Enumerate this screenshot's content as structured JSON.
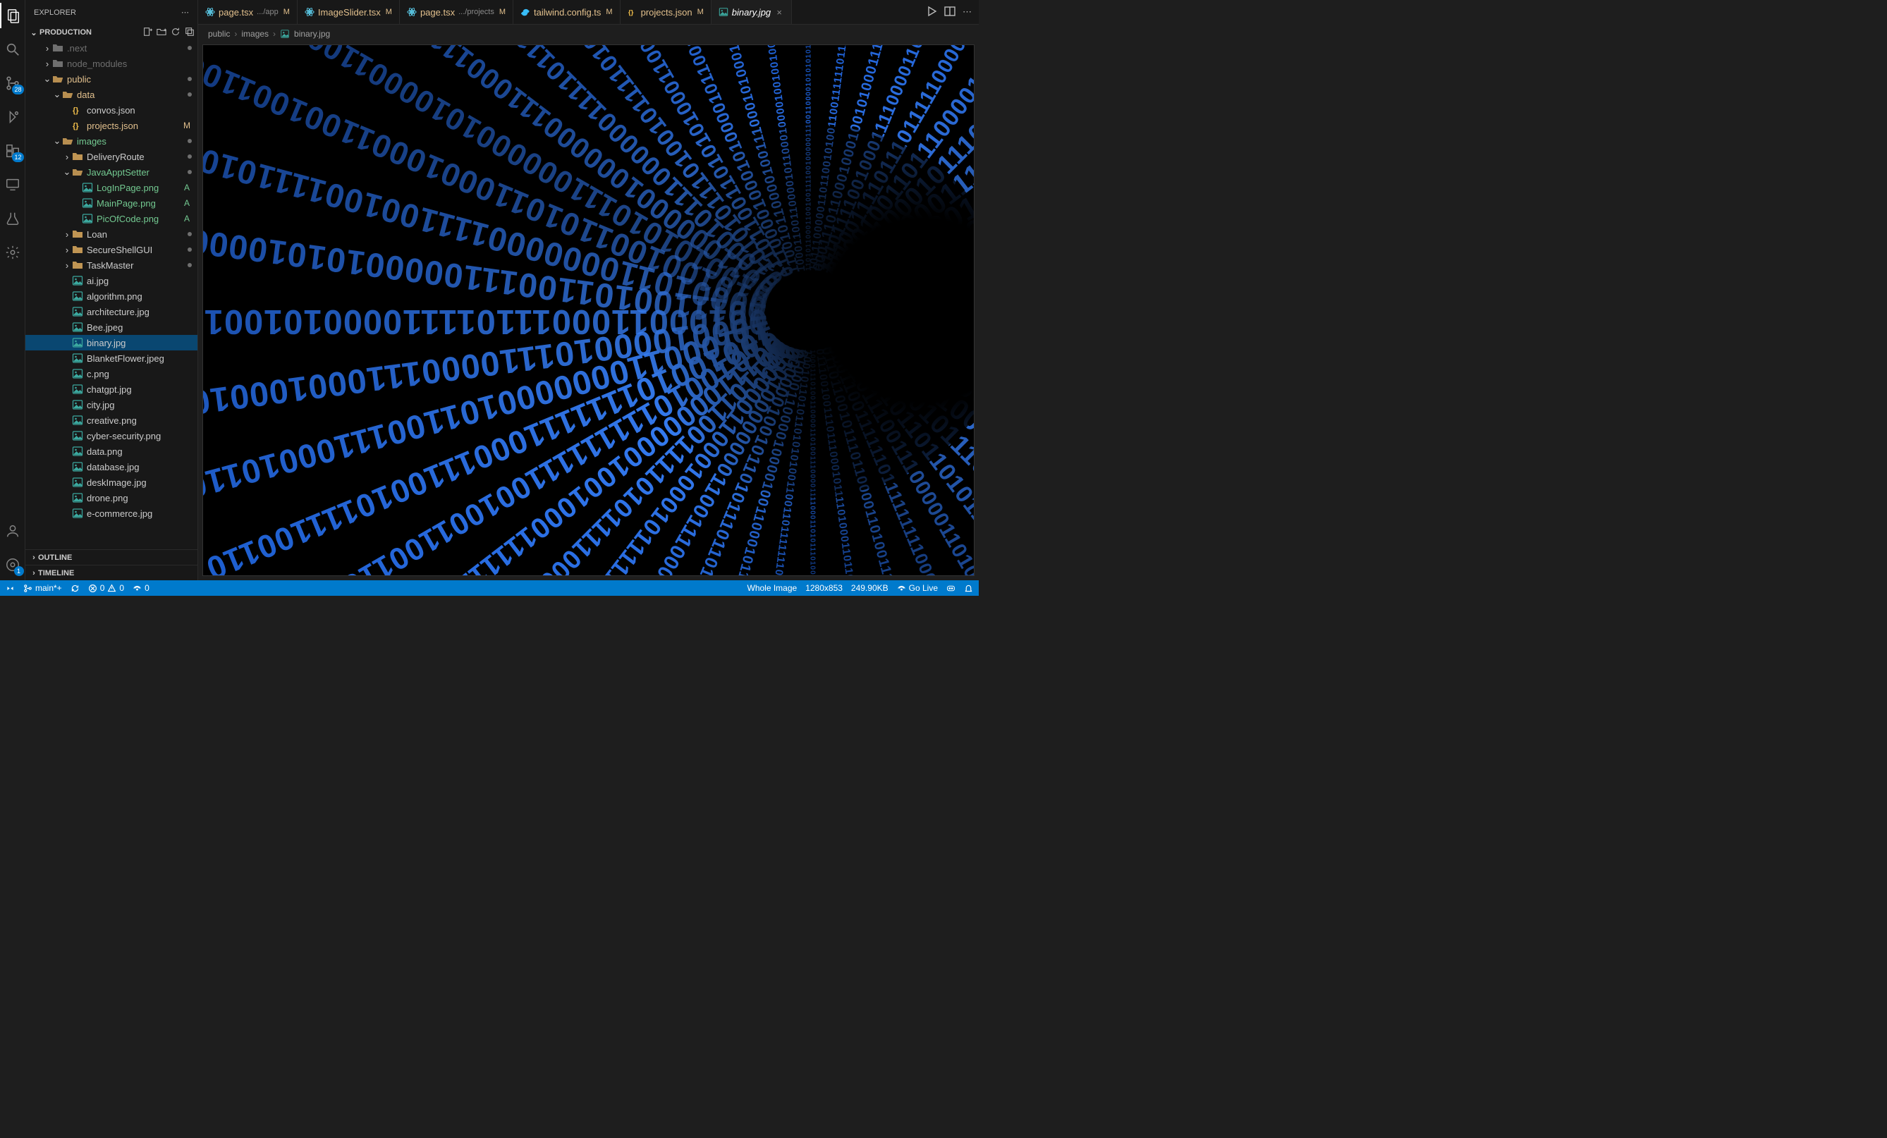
{
  "sidebar_title": "EXPLORER",
  "project_name": "PRODUCTION",
  "badges": {
    "scm": "28",
    "ext": "12",
    "remote": "1"
  },
  "tree": [
    {
      "id": "next",
      "depth": 2,
      "type": "folder",
      "open": false,
      "label": ".next",
      "color": "dim",
      "dot": true
    },
    {
      "id": "node_modules",
      "depth": 2,
      "type": "folder",
      "open": false,
      "label": "node_modules",
      "color": "dim"
    },
    {
      "id": "public",
      "depth": 2,
      "type": "folder",
      "open": true,
      "label": "public",
      "color": "modified",
      "dot": true
    },
    {
      "id": "data",
      "depth": 3,
      "type": "folder",
      "open": true,
      "label": "data",
      "color": "modified",
      "dot": true
    },
    {
      "id": "convos",
      "depth": 4,
      "type": "json",
      "label": "convos.json",
      "color": "default"
    },
    {
      "id": "projects",
      "depth": 4,
      "type": "json",
      "label": "projects.json",
      "color": "modified",
      "status": "M"
    },
    {
      "id": "images",
      "depth": 3,
      "type": "folder",
      "open": true,
      "label": "images",
      "color": "untracked",
      "dot": true
    },
    {
      "id": "deliveryroute",
      "depth": 4,
      "type": "folder",
      "open": false,
      "label": "DeliveryRoute",
      "color": "default",
      "dot": true
    },
    {
      "id": "javaapptsetter",
      "depth": 4,
      "type": "folder",
      "open": true,
      "label": "JavaApptSetter",
      "color": "untracked",
      "dot": true
    },
    {
      "id": "login",
      "depth": 5,
      "type": "img",
      "label": "LogInPage.png",
      "color": "untracked",
      "status": "A"
    },
    {
      "id": "mainpage",
      "depth": 5,
      "type": "img",
      "label": "MainPage.png",
      "color": "untracked",
      "status": "A"
    },
    {
      "id": "picofcode",
      "depth": 5,
      "type": "img",
      "label": "PicOfCode.png",
      "color": "untracked",
      "status": "A"
    },
    {
      "id": "loan",
      "depth": 4,
      "type": "folder",
      "open": false,
      "label": "Loan",
      "color": "default",
      "dot": true
    },
    {
      "id": "secureshell",
      "depth": 4,
      "type": "folder",
      "open": false,
      "label": "SecureShellGUI",
      "color": "default",
      "dot": true
    },
    {
      "id": "taskmaster",
      "depth": 4,
      "type": "folder",
      "open": false,
      "label": "TaskMaster",
      "color": "default",
      "dot": true
    },
    {
      "id": "ai",
      "depth": 4,
      "type": "img",
      "label": "ai.jpg",
      "color": "default"
    },
    {
      "id": "algorithm",
      "depth": 4,
      "type": "img",
      "label": "algorithm.png",
      "color": "default"
    },
    {
      "id": "architecture",
      "depth": 4,
      "type": "img",
      "label": "architecture.jpg",
      "color": "default"
    },
    {
      "id": "bee",
      "depth": 4,
      "type": "img",
      "label": "Bee.jpeg",
      "color": "default"
    },
    {
      "id": "binary",
      "depth": 4,
      "type": "img",
      "label": "binary.jpg",
      "color": "default",
      "selected": true
    },
    {
      "id": "blanket",
      "depth": 4,
      "type": "img",
      "label": "BlanketFlower.jpeg",
      "color": "default"
    },
    {
      "id": "cpng",
      "depth": 4,
      "type": "img",
      "label": "c.png",
      "color": "default"
    },
    {
      "id": "chatgpt",
      "depth": 4,
      "type": "img",
      "label": "chatgpt.jpg",
      "color": "default"
    },
    {
      "id": "city",
      "depth": 4,
      "type": "img",
      "label": "city.jpg",
      "color": "default"
    },
    {
      "id": "creative",
      "depth": 4,
      "type": "img",
      "label": "creative.png",
      "color": "default"
    },
    {
      "id": "cyber",
      "depth": 4,
      "type": "img",
      "label": "cyber-security.png",
      "color": "default"
    },
    {
      "id": "datapng",
      "depth": 4,
      "type": "img",
      "label": "data.png",
      "color": "default"
    },
    {
      "id": "database",
      "depth": 4,
      "type": "img",
      "label": "database.jpg",
      "color": "default"
    },
    {
      "id": "deskimage",
      "depth": 4,
      "type": "img",
      "label": "deskImage.jpg",
      "color": "default"
    },
    {
      "id": "drone",
      "depth": 4,
      "type": "img",
      "label": "drone.png",
      "color": "default"
    },
    {
      "id": "ecommerce",
      "depth": 4,
      "type": "img",
      "label": "e-commerce.jpg",
      "color": "default"
    }
  ],
  "collapsed_sections": [
    "OUTLINE",
    "TIMELINE"
  ],
  "tabs": [
    {
      "icon": "react",
      "label": "page.tsx",
      "desc": ".../app",
      "status": "M",
      "color": "modified"
    },
    {
      "icon": "react",
      "label": "ImageSlider.tsx",
      "status": "M",
      "color": "modified"
    },
    {
      "icon": "react",
      "label": "page.tsx",
      "desc": ".../projects",
      "status": "M",
      "color": "modified"
    },
    {
      "icon": "tailwind",
      "label": "tailwind.config.ts",
      "status": "M",
      "color": "modified"
    },
    {
      "icon": "json",
      "label": "projects.json",
      "status": "M",
      "color": "modified"
    },
    {
      "icon": "img",
      "label": "binary.jpg",
      "active": true,
      "italic": true,
      "close": true
    }
  ],
  "breadcrumb": [
    "public",
    "images",
    "binary.jpg"
  ],
  "status": {
    "branch": "main*+",
    "errors": "0",
    "warnings": "0",
    "port": "0",
    "whole_image": "Whole Image",
    "dimensions": "1280x853",
    "size": "249.90KB",
    "golive": "Go Live"
  }
}
